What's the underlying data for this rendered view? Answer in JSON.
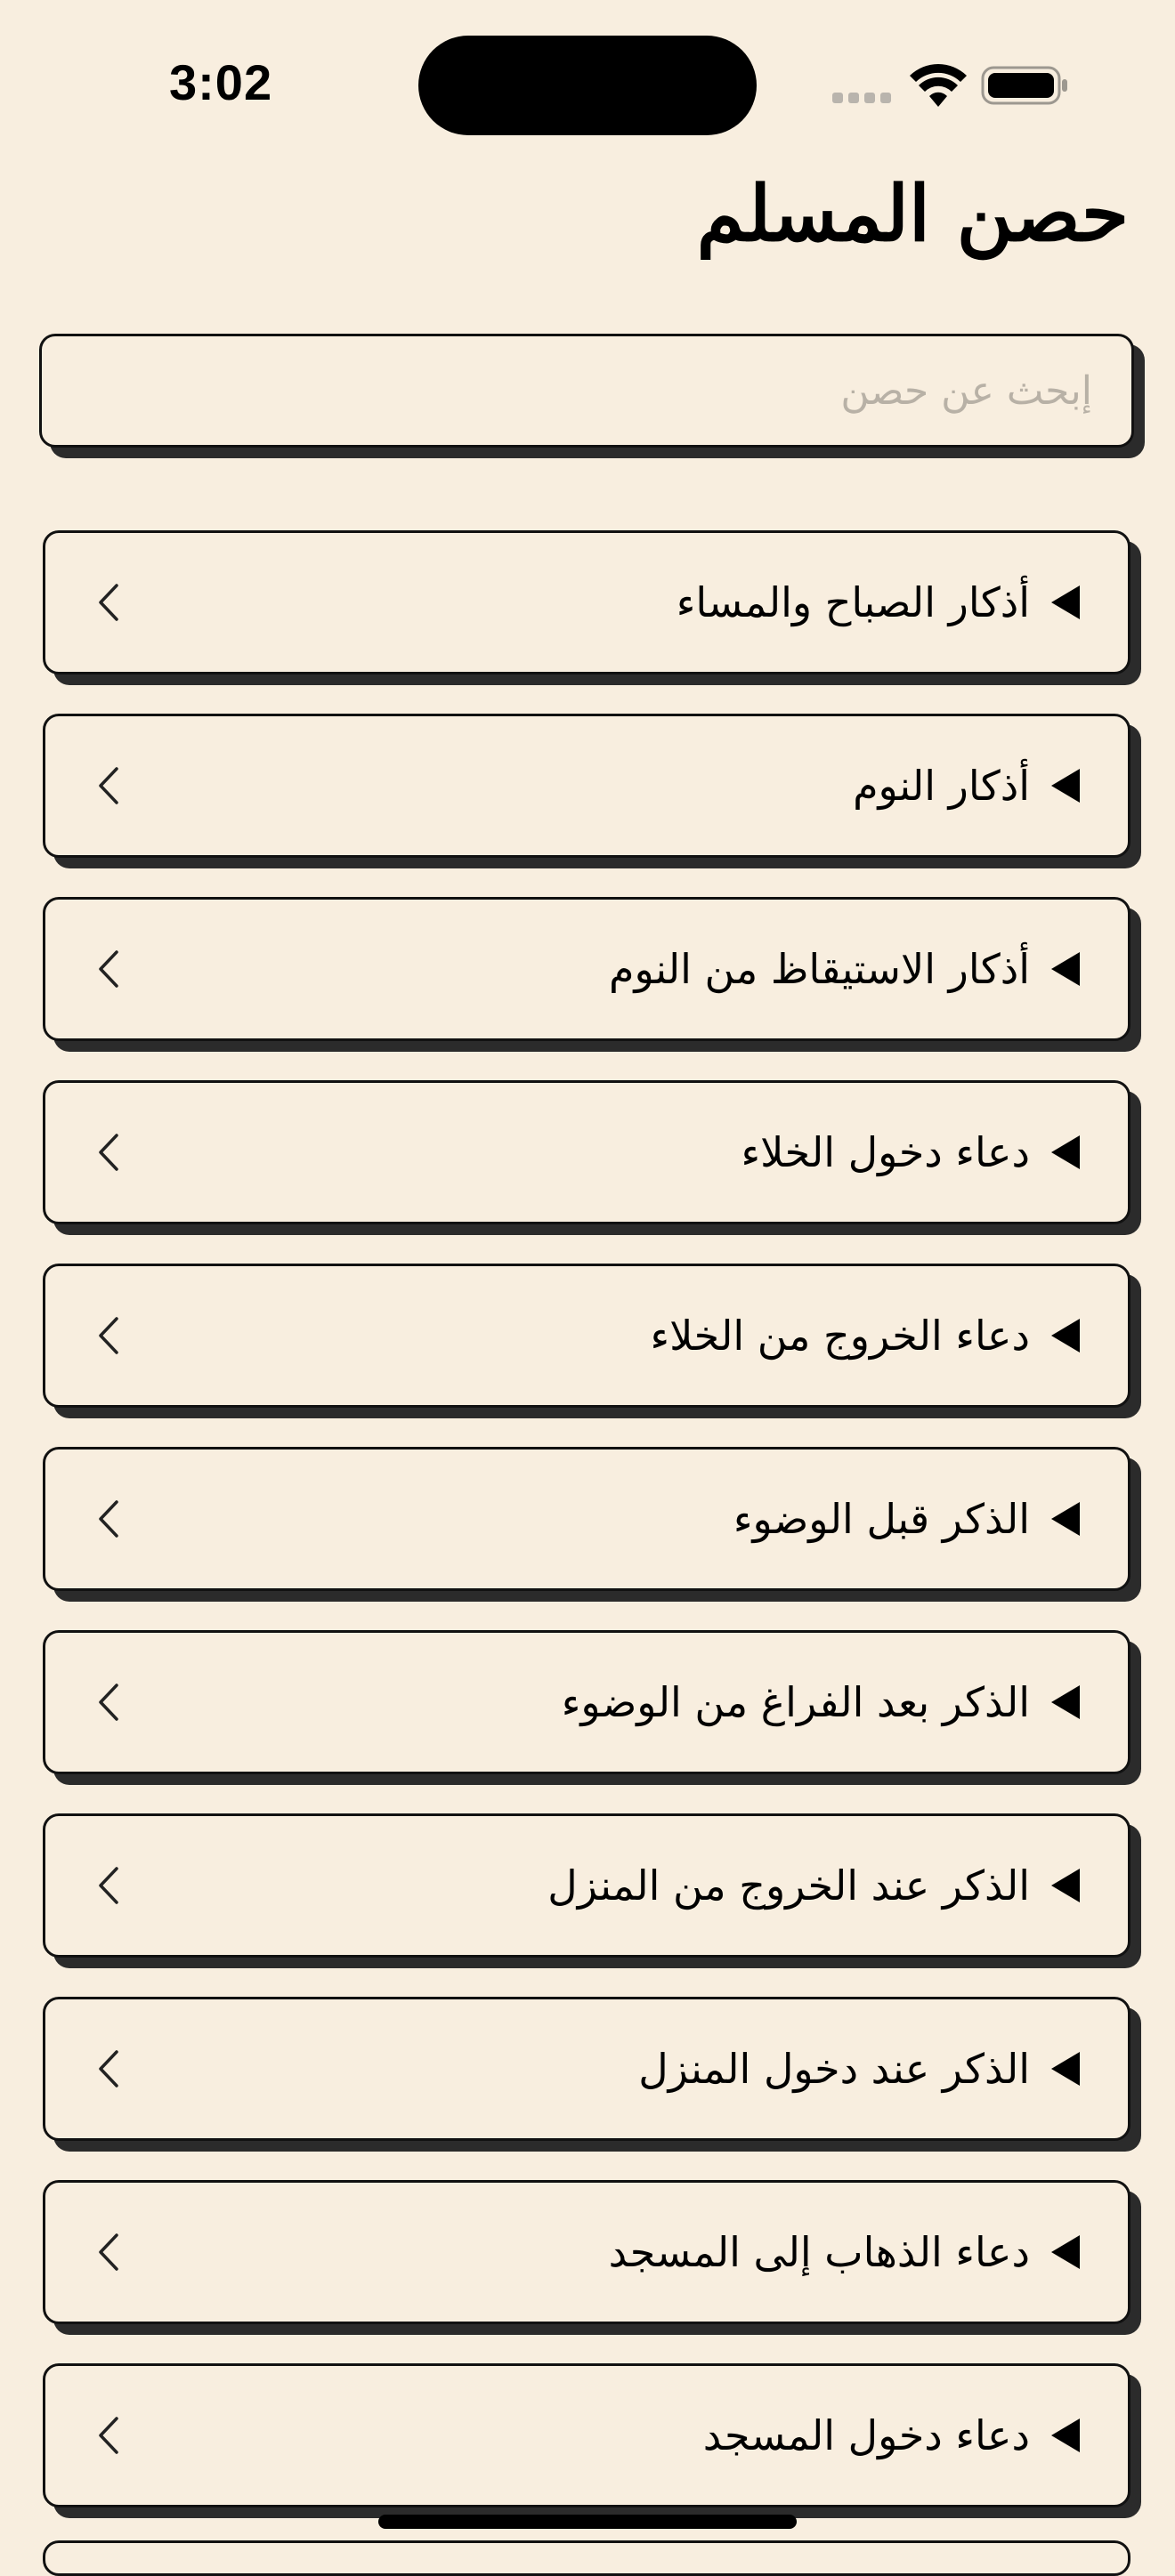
{
  "status_bar": {
    "time": "3:02",
    "icons": [
      "signal-icon",
      "wifi-icon",
      "battery-icon"
    ]
  },
  "header": {
    "title": "حصن المسلم"
  },
  "search": {
    "placeholder": "إبحث عن حصن",
    "value": ""
  },
  "list": {
    "items": [
      {
        "label": "أذكار الصباح والمساء"
      },
      {
        "label": "أذكار النوم"
      },
      {
        "label": "أذكار الاستيقاظ من النوم"
      },
      {
        "label": "دعاء دخول الخلاء"
      },
      {
        "label": "دعاء الخروج من الخلاء"
      },
      {
        "label": "الذكر قبل الوضوء"
      },
      {
        "label": "الذكر بعد الفراغ من الوضوء"
      },
      {
        "label": "الذكر عند الخروج من المنزل"
      },
      {
        "label": "الذكر عند دخول المنزل"
      },
      {
        "label": "دعاء الذهاب إلى المسجد"
      },
      {
        "label": "دعاء دخول المسجد"
      }
    ]
  },
  "colors": {
    "background": "#f8eedf",
    "border": "#111111",
    "shadow": "#2b2b2b",
    "placeholder": "#b8b1a6"
  }
}
